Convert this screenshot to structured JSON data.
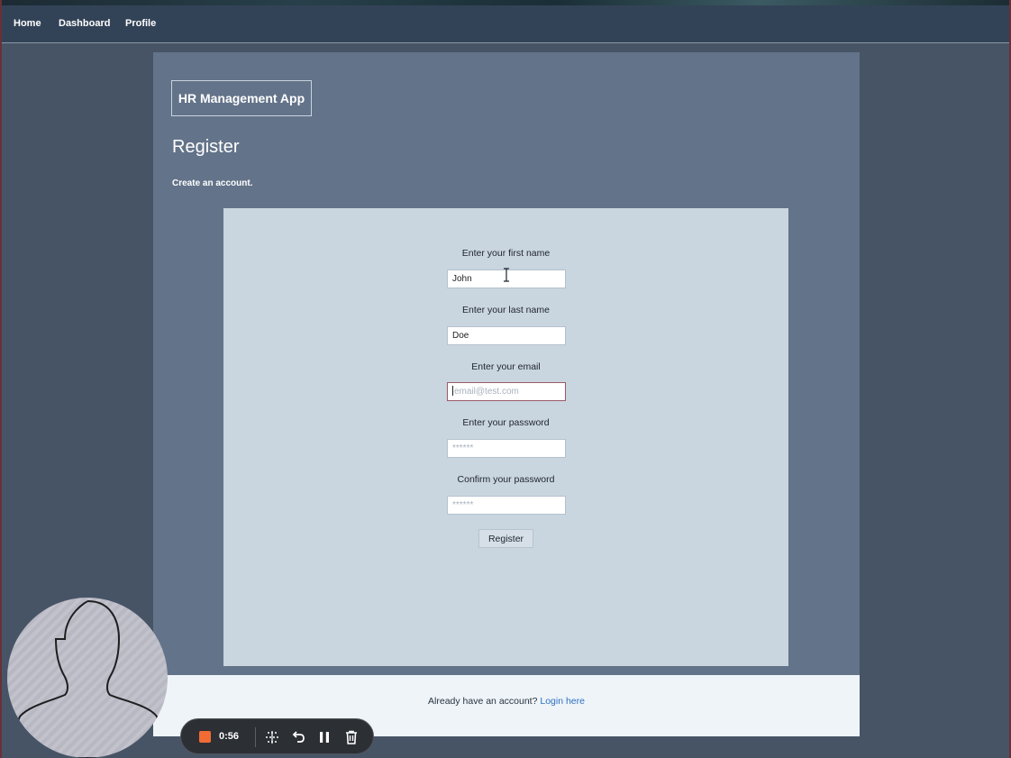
{
  "nav": {
    "items": [
      {
        "label": "Home"
      },
      {
        "label": "Dashboard"
      },
      {
        "label": "Profile"
      }
    ]
  },
  "header": {
    "brand": "HR Management App",
    "title": "Register",
    "subtitle": "Create an account."
  },
  "form": {
    "first_name": {
      "label": "Enter your first name",
      "value": "John"
    },
    "last_name": {
      "label": "Enter your last name",
      "value": "Doe"
    },
    "email": {
      "label": "Enter your email",
      "value": "",
      "placeholder": "email@test.com"
    },
    "password": {
      "label": "Enter your password",
      "value": "",
      "placeholder": "******"
    },
    "confirm_password": {
      "label": "Confirm your password",
      "value": "",
      "placeholder": "******"
    },
    "submit_label": "Register"
  },
  "footer": {
    "prompt": "Already have an account?",
    "link": "Login here"
  },
  "recorder": {
    "time": "0:56",
    "icons": [
      "stop-icon",
      "grid-dots-icon",
      "undo-icon",
      "pause-icon",
      "trash-icon"
    ]
  },
  "colors": {
    "background": "#475466",
    "navbar": "#334357",
    "panel": "#637389",
    "card": "#c9d5df",
    "link": "#2f6fc1",
    "record": "#f26b35"
  }
}
